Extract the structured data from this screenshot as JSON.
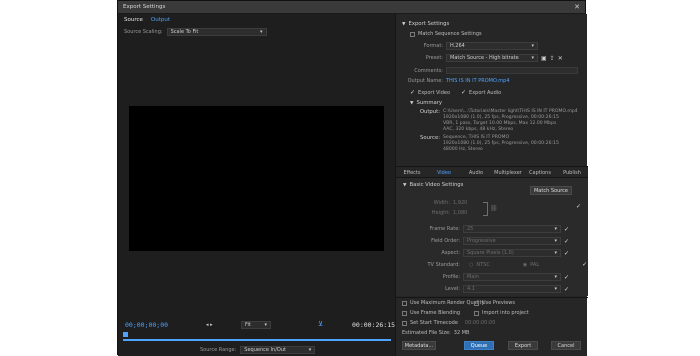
{
  "window": {
    "title": "Export Settings",
    "close_glyph": "✕"
  },
  "source_panel": {
    "tabs": [
      "Source",
      "Output"
    ],
    "scaling_label": "Source Scaling:",
    "scaling_value": "Scale To Fit",
    "timecode_in": "00;00;00;00",
    "timecode_out": "00:00:26:15",
    "fit_value": "Fit",
    "source_range_label": "Source Range:",
    "source_range_value": "Sequence In/Out"
  },
  "export_settings": {
    "title": "Export Settings",
    "match_sequence_label": "Match Sequence Settings",
    "format_label": "Format:",
    "format_value": "H.264",
    "preset_label": "Preset:",
    "preset_value": "Match Source - High bitrate",
    "comments_label": "Comments:",
    "output_name_label": "Output Name:",
    "output_name_value": "THIS IS IN IT PROMO.mp4",
    "export_video_label": "Export Video",
    "export_audio_label": "Export Audio",
    "summary_title": "Summary",
    "output_label": "Output:",
    "output_lines": [
      "C:\\Users\\...\\Tutorials\\Master light\\THIS IS IN IT PROMO.mp4",
      "1920x1080 (1.0), 25 fps, Progressive, 00:00:26:15",
      "VBR, 1 pass, Target 10.00 Mbps, Max 12.00 Mbps",
      "AAC, 320 kbps, 48 kHz, Stereo"
    ],
    "source_label": "Source:",
    "source_lines": [
      "Sequence, THIS IS IT PROMO",
      "1920x1080 (1.0), 25 fps, Progressive, 00:00:26:15",
      "48000 Hz, Stereo"
    ]
  },
  "tabs": [
    "Effects",
    "Video",
    "Audio",
    "Multiplexer",
    "Captions",
    "Publish"
  ],
  "video": {
    "section_title": "Basic Video Settings",
    "match_source_button": "Match Source",
    "width_label": "Width:",
    "width_value": "1,920",
    "height_label": "Height:",
    "height_value": "1,080",
    "frame_rate_label": "Frame Rate:",
    "frame_rate_value": "25",
    "field_order_label": "Field Order:",
    "field_order_value": "Progressive",
    "aspect_label": "Aspect:",
    "aspect_value": "Square Pixels (1.0)",
    "tv_standard_label": "TV Standard:",
    "ntsc_label": "NTSC",
    "pal_label": "PAL",
    "profile_label": "Profile:",
    "profile_value": "Main",
    "level_label": "Level:",
    "level_value": "4.1"
  },
  "options": {
    "max_render_quality": "Use Maximum Render Quality",
    "use_previews": "Use Previews",
    "frame_blending": "Use Frame Blending",
    "import_into_project": "Import into project",
    "set_start_timecode": "Set Start Timecode",
    "start_timecode_value": "00:00:00:00",
    "file_size_label": "Estimated File Size:",
    "file_size_value": "32 MB"
  },
  "buttons": {
    "metadata": "Metadata...",
    "queue": "Queue",
    "export": "Export",
    "cancel": "Cancel"
  },
  "colors": {
    "accent": "#4ea3ff",
    "window_bg": "#232323",
    "preview_bg": "#000000"
  }
}
